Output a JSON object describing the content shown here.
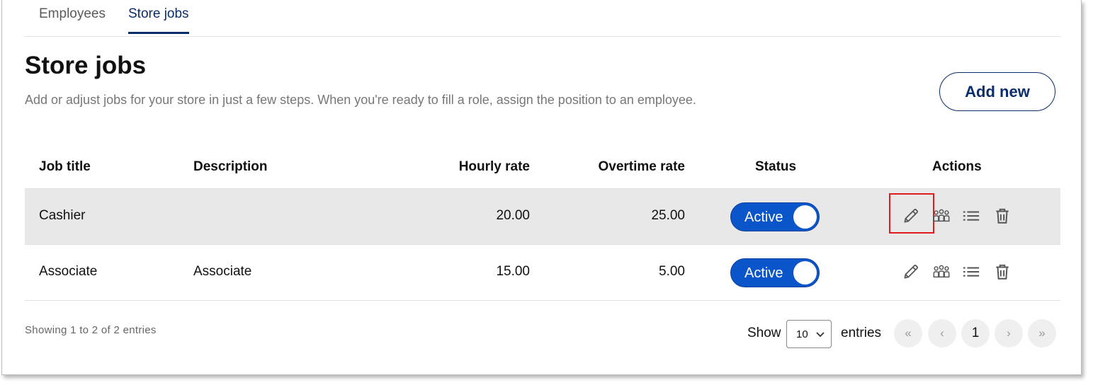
{
  "tabs": [
    {
      "label": "Employees",
      "active": false
    },
    {
      "label": "Store jobs",
      "active": true
    }
  ],
  "page": {
    "title": "Store jobs",
    "subtitle": "Add or adjust jobs for your store in just a few steps. When you're ready to fill a role, assign the position to an employee.",
    "add_button": "Add new"
  },
  "table": {
    "headers": {
      "job_title": "Job title",
      "description": "Description",
      "hourly_rate": "Hourly rate",
      "overtime_rate": "Overtime rate",
      "status": "Status",
      "actions": "Actions"
    },
    "rows": [
      {
        "job_title": "Cashier",
        "description": "",
        "hourly_rate": "20.00",
        "overtime_rate": "25.00",
        "status": "Active",
        "active": true
      },
      {
        "job_title": "Associate",
        "description": "Associate",
        "hourly_rate": "15.00",
        "overtime_rate": "5.00",
        "status": "Active",
        "active": true
      }
    ],
    "action_icons": [
      "pencil-icon",
      "team-icon",
      "list-icon",
      "trash-icon"
    ]
  },
  "footer": {
    "info": "Showing 1 to 2 of 2 entries",
    "show_label": "Show",
    "page_size": "10",
    "entries_label": "entries",
    "pagination": {
      "first": "«",
      "prev": "‹",
      "current": "1",
      "next": "›",
      "last": "»"
    }
  },
  "colors": {
    "brand_navy": "#0b2d6b",
    "toggle_blue": "#0a55c9",
    "highlight_red": "#e01b1b",
    "row_shade": "#e8e8e8"
  }
}
